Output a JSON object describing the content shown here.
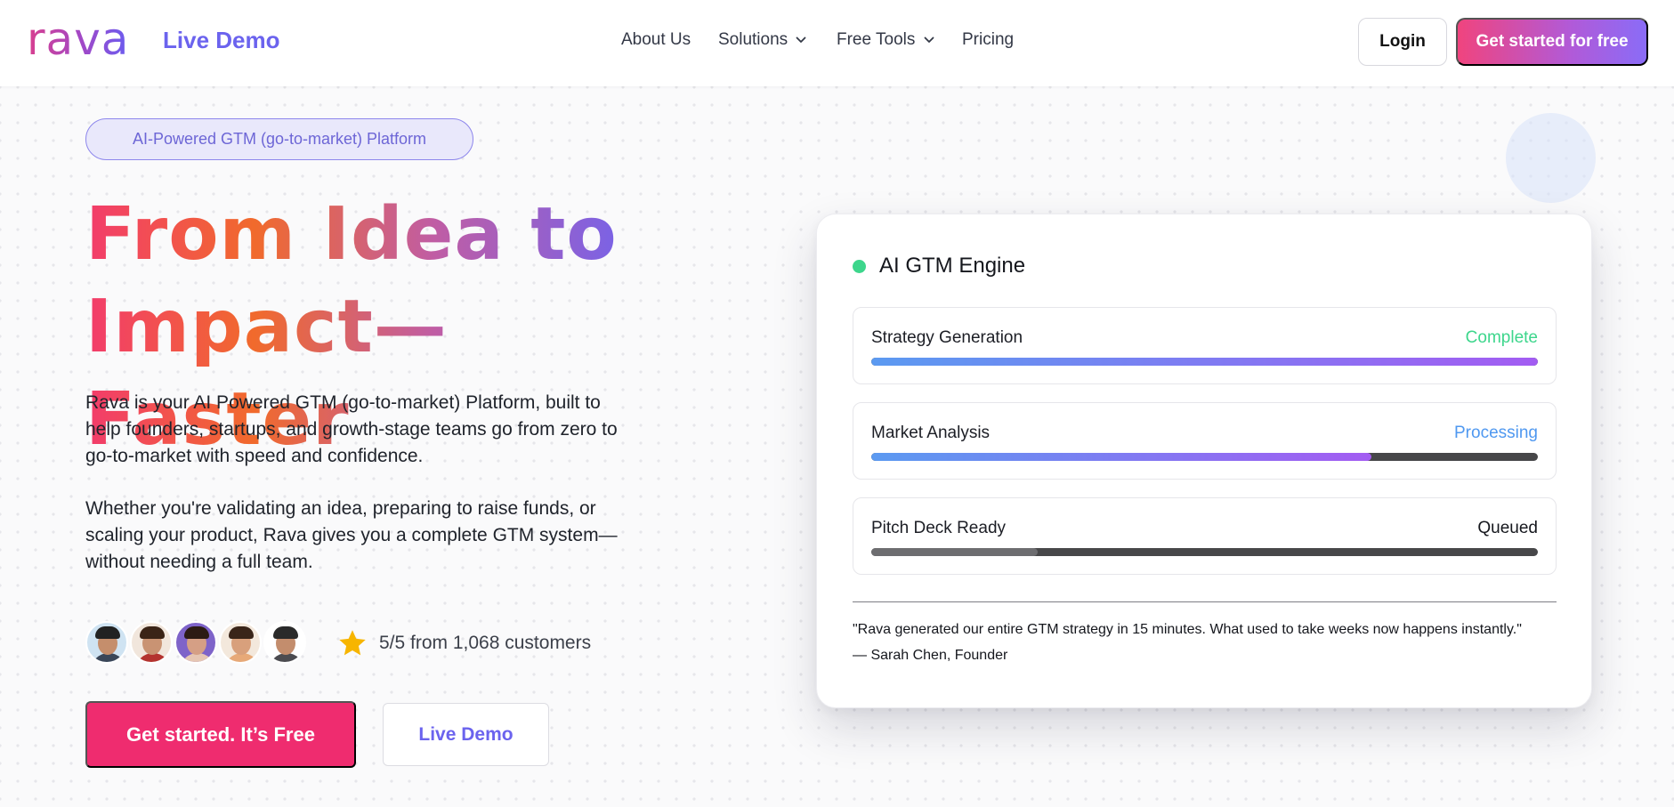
{
  "header": {
    "logo": "rava",
    "live_demo": "Live Demo",
    "nav": [
      {
        "label": "About Us",
        "dropdown": false
      },
      {
        "label": "Solutions",
        "dropdown": true
      },
      {
        "label": "Free Tools",
        "dropdown": true
      },
      {
        "label": "Pricing",
        "dropdown": false
      }
    ],
    "login": "Login",
    "cta": "Get started for free"
  },
  "hero": {
    "pill": "AI-Powered GTM (go-to-market) Platform",
    "headline_line1": "From Idea to",
    "headline_line2": "Impact—Faster",
    "para1": "Rava is your AI Powered GTM (go-to-market) Platform, built to help founders, startups, and growth-stage teams go from zero to go-to-market with speed and confidence.",
    "para2": "Whether you're validating an idea, preparing to raise funds, or scaling your product, Rava gives you a complete GTM system—without needing a full team.",
    "rating": "5/5 from 1,068 customers",
    "cta_primary": "Get started. It’s Free",
    "cta_secondary": "Live Demo"
  },
  "engine": {
    "title": "AI GTM Engine",
    "tasks": [
      {
        "name": "Strategy Generation",
        "status": "Complete",
        "progress": 1.0,
        "status_color": "#3dd68c"
      },
      {
        "name": "Market Analysis",
        "status": "Processing",
        "progress": 0.75,
        "status_color": "#4f98f0"
      },
      {
        "name": "Pitch Deck Ready",
        "status": "Queued",
        "progress": 0.25,
        "status_color": "#15171d"
      }
    ],
    "quote": "\"Rava generated our entire GTM strategy in 15 minutes. What used to take weeks now happens instantly.\"",
    "author": "— Sarah Chen, Founder"
  },
  "colors": {
    "brand_purple": "#6b63ee",
    "brand_pink": "#ef2c6f",
    "status_green": "#3dd68c"
  },
  "icons": [
    "chevron-down-icon",
    "star-icon",
    "status-dot-icon"
  ]
}
